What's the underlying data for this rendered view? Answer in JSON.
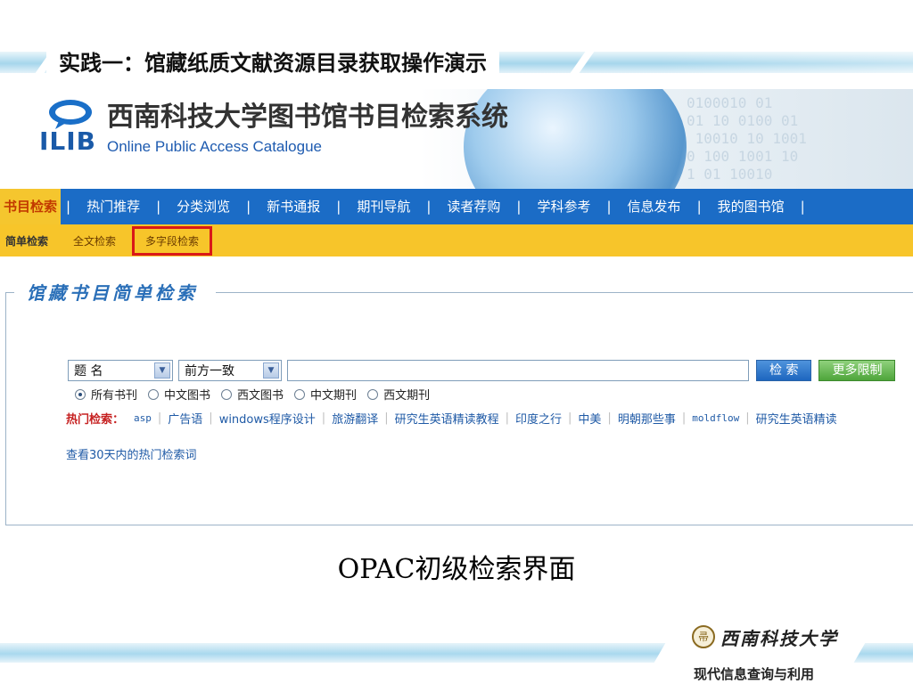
{
  "slide": {
    "title": "实践一：馆藏纸质文献资源目录获取操作演示",
    "caption": "OPAC初级检索界面",
    "university": "西南科技大学",
    "course": "现代信息查询与利用"
  },
  "opac": {
    "logo_text": "ILIB",
    "system_title": "西南科技大学图书馆书目检索系统",
    "system_subtitle": "Online Public Access Catalogue",
    "binary_decor": "0100010 01\n01 10 0100 01\n 10010 10 1001\n0 100 1001 10\n1 01 10010",
    "nav": [
      "书目检索",
      "热门推荐",
      "分类浏览",
      "新书通报",
      "期刊导航",
      "读者荐购",
      "学科参考",
      "信息发布",
      "我的图书馆"
    ],
    "sub_nav": [
      "简单检索",
      "全文检索",
      "多字段检索"
    ],
    "panel_title": "馆藏书目简单检索",
    "search": {
      "field_select": "题 名",
      "match_select": "前方一致",
      "input_value": "",
      "search_button": "检 索",
      "more_button": "更多限制"
    },
    "scopes": [
      "所有书刊",
      "中文图书",
      "西文图书",
      "中文期刊",
      "西文期刊"
    ],
    "hot_label": "热门检索：",
    "hot_terms": [
      "asp",
      "广告语",
      "windows程序设计",
      "旅游翻译",
      "研究生英语精读教程",
      "印度之行",
      "中美",
      "明朝那些事",
      "moldflow",
      "研究生英语精读"
    ],
    "see_hot": "查看30天内的热门检索词"
  },
  "colors": {
    "nav_blue": "#1b6cc6",
    "nav_yellow": "#f7c52a",
    "highlight_box": "#d91818",
    "link_blue": "#1f5aa6",
    "hot_red": "#c62121"
  }
}
